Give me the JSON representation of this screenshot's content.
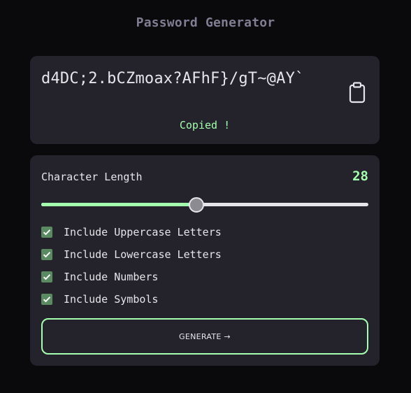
{
  "app": {
    "title": "Password Generator"
  },
  "output": {
    "password": "d4DC;2.bCZmoax?AFhF}/gT~@AY`",
    "copy_icon": "clipboard-icon",
    "status": "Copied !"
  },
  "settings": {
    "length_label": "Character Length",
    "length_value": "28",
    "slider_fraction": 0.475,
    "options": [
      {
        "label": "Include Uppercase Letters",
        "checked": true
      },
      {
        "label": "Include Lowercase Letters",
        "checked": true
      },
      {
        "label": "Include Numbers",
        "checked": true
      },
      {
        "label": "Include Symbols",
        "checked": true
      }
    ],
    "generate_label": "GENERATE →"
  },
  "colors": {
    "background": "#0a0a0d",
    "card": "#24232c",
    "accent": "#a4ffaf",
    "checkbox": "#5a8a62",
    "muted": "#817d92",
    "text": "#e6e5ea"
  }
}
